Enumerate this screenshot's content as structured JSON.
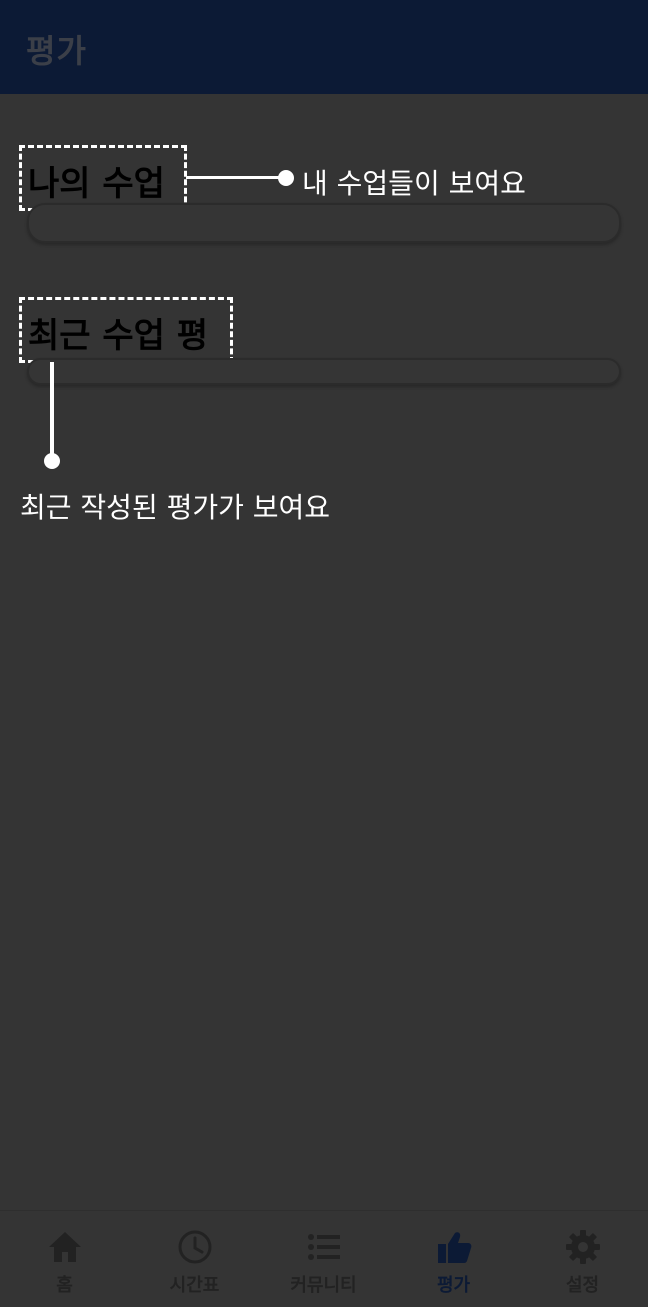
{
  "header": {
    "title": "평가"
  },
  "my_classes": {
    "heading": "나의 수업",
    "annotation": "내 수업들이 보여요"
  },
  "recent_reviews": {
    "heading": "최근 수업 평",
    "annotation": "최근 작성된 평가가 보여요"
  },
  "bottom_nav": {
    "items": [
      {
        "label": "홈",
        "icon": "home-icon"
      },
      {
        "label": "시간표",
        "icon": "clock-icon"
      },
      {
        "label": "커뮤니티",
        "icon": "list-icon"
      },
      {
        "label": "평가",
        "icon": "thumbs-up-icon",
        "active": true
      },
      {
        "label": "설정",
        "icon": "gear-icon"
      }
    ]
  },
  "colors": {
    "overlay_background": "#343434",
    "header_background": "#0c1a35",
    "active_nav": "#0c1a35",
    "annotation": "#ffffff"
  }
}
